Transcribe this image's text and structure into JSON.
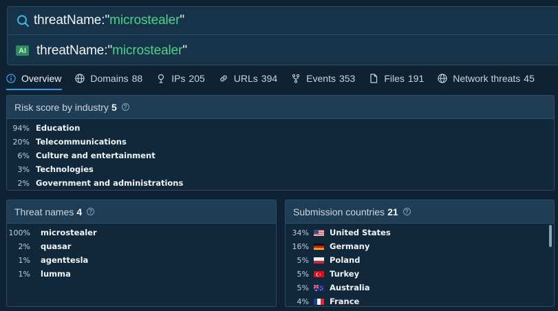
{
  "search": {
    "query_key": "threatName:\"",
    "query_value": "microstealer",
    "query_end": "\"",
    "ai_badge": "AI",
    "suggestion_key": "threatName:\"",
    "suggestion_value": "microstealer",
    "suggestion_end": "\""
  },
  "tabs": [
    {
      "label": "Overview",
      "count": "",
      "icon": "info-icon",
      "active": true
    },
    {
      "label": "Domains",
      "count": "88",
      "icon": "globe-icon"
    },
    {
      "label": "IPs",
      "count": "205",
      "icon": "pin-icon"
    },
    {
      "label": "URLs",
      "count": "394",
      "icon": "link-icon"
    },
    {
      "label": "Events",
      "count": "353",
      "icon": "fork-icon"
    },
    {
      "label": "Files",
      "count": "191",
      "icon": "file-icon"
    },
    {
      "label": "Network threats",
      "count": "45",
      "icon": "globe-icon"
    }
  ],
  "risk": {
    "title": "Risk score by industry",
    "count": "5",
    "rows": [
      {
        "pct": "94%",
        "label": "Education"
      },
      {
        "pct": "20%",
        "label": "Telecommunications"
      },
      {
        "pct": "6%",
        "label": "Culture and entertainment"
      },
      {
        "pct": "3%",
        "label": "Technologies"
      },
      {
        "pct": "2%",
        "label": "Government and administrations"
      }
    ]
  },
  "threats": {
    "title": "Threat names",
    "count": "4",
    "rows": [
      {
        "pct": "100%",
        "label": "microstealer"
      },
      {
        "pct": "2%",
        "label": "quasar"
      },
      {
        "pct": "1%",
        "label": "agenttesla"
      },
      {
        "pct": "1%",
        "label": "lumma"
      }
    ]
  },
  "countries": {
    "title": "Submission countries",
    "count": "21",
    "rows": [
      {
        "pct": "34%",
        "label": "United States",
        "flag": "us-flag-icon"
      },
      {
        "pct": "16%",
        "label": "Germany",
        "flag": "de-flag-icon"
      },
      {
        "pct": "5%",
        "label": "Poland",
        "flag": "pl-flag-icon"
      },
      {
        "pct": "5%",
        "label": "Turkey",
        "flag": "tr-flag-icon"
      },
      {
        "pct": "5%",
        "label": "Australia",
        "flag": "au-flag-icon"
      },
      {
        "pct": "4%",
        "label": "France",
        "flag": "fr-flag-icon"
      }
    ]
  },
  "colors": {
    "accent": "#3a9fd6",
    "query_value": "#4cd488",
    "background": "#0e2233"
  }
}
